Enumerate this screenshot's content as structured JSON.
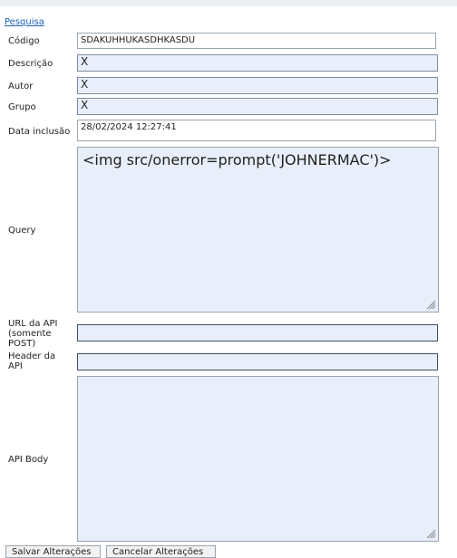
{
  "link": {
    "label": "Pesquisa"
  },
  "form": {
    "codigo": {
      "label": "Código",
      "value": "SDAKUHHUKASDHKASDU"
    },
    "descricao": {
      "label": "Descrição",
      "value": "X"
    },
    "autor": {
      "label": "Autor",
      "value": "X"
    },
    "grupo": {
      "label": "Grupo",
      "value": "X"
    },
    "data_inclusao": {
      "label": "Data inclusão",
      "value": "28/02/2024 12:27:41"
    },
    "query": {
      "label": "Query",
      "value": "<img src/onerror=prompt('JOHNERMAC')>"
    },
    "url_api": {
      "label_lines": [
        "URL da API",
        "(somente",
        "POST)"
      ],
      "value": ""
    },
    "header_api": {
      "label_lines": [
        "Header da",
        "API"
      ],
      "value": ""
    },
    "api_body": {
      "label": "API Body",
      "value": ""
    }
  },
  "buttons": {
    "left_partial": "Salvar Alterações",
    "right_partial": "Cancelar Alterações"
  },
  "colors": {
    "input_blue_bg": "#e8effa",
    "link": "#1a5fb4",
    "border": "#9aa6b0"
  }
}
